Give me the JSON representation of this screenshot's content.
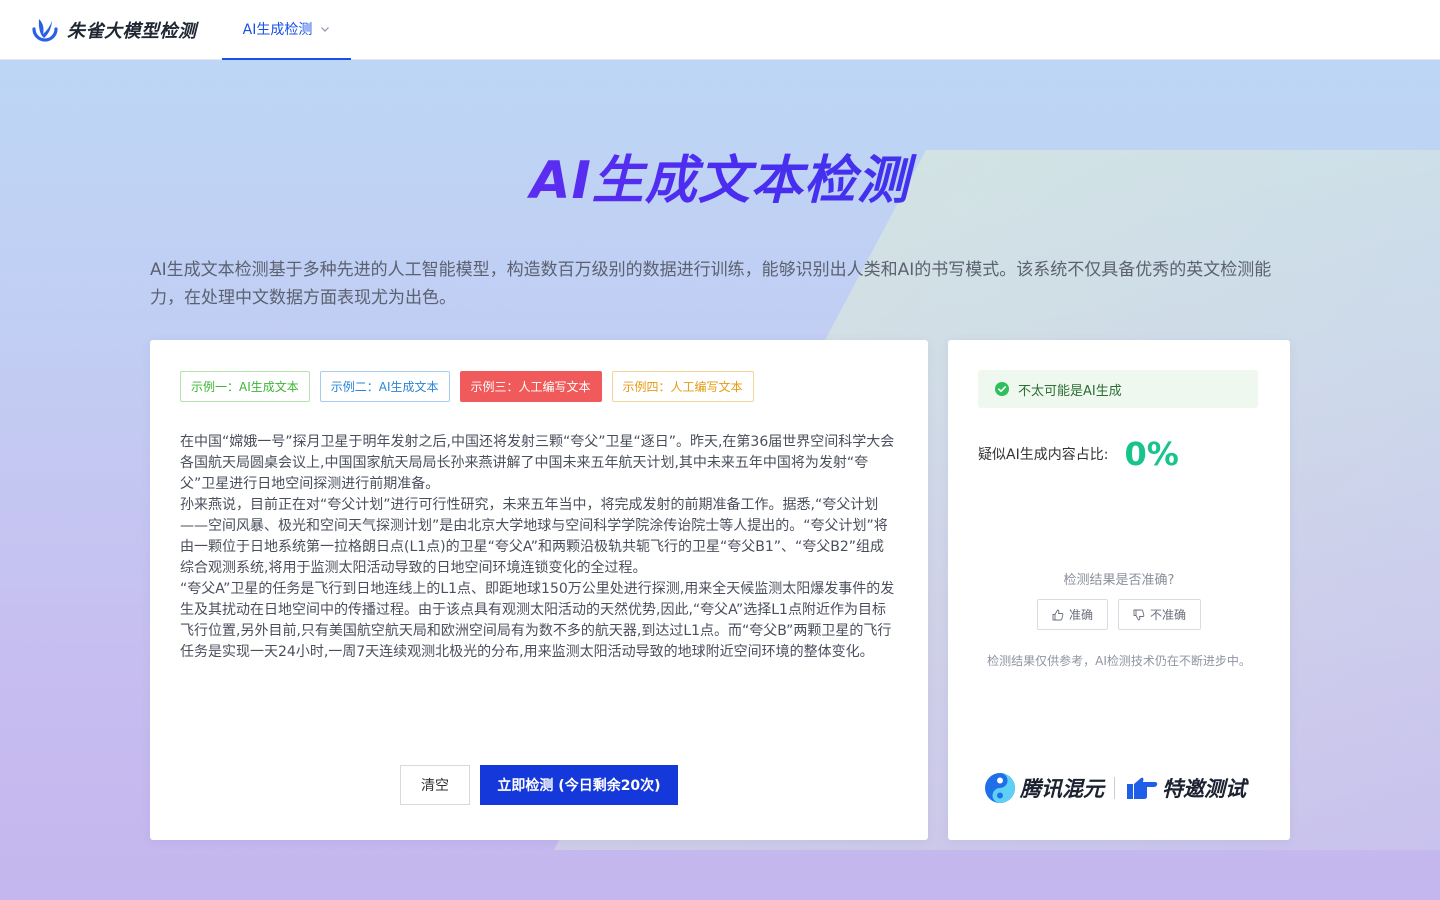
{
  "header": {
    "brand": "朱雀大模型检测",
    "nav_tab": "AI生成检测"
  },
  "hero": {
    "title": "AI生成文本检测",
    "description": "AI生成文本检测基于多种先进的人工智能模型，构造数百万级别的数据进行训练，能够识别出人类和AI的书写模式。该系统不仅具备优秀的英文检测能力，在处理中文数据方面表现尤为出色。"
  },
  "examples": [
    "示例一：AI生成文本",
    "示例二：AI生成文本",
    "示例三：人工编写文本",
    "示例四：人工编写文本"
  ],
  "input_text": {
    "paragraphs": [
      "在中国“嫦娥一号”探月卫星于明年发射之后,中国还将发射三颗“夸父”卫星“逐日”。昨天,在第36届世界空间科学大会各国航天局圆桌会议上,中国国家航天局局长孙来燕讲解了中国未来五年航天计划,其中未来五年中国将为发射“夸父”卫星进行日地空间探测进行前期准备。",
      "孙来燕说，目前正在对“夸父计划”进行可行性研究，未来五年当中，将完成发射的前期准备工作。据悉,“夸父计划——空间风暴、极光和空间天气探测计划”是由北京大学地球与空间科学学院涂传诒院士等人提出的。“夸父计划”将由一颗位于日地系统第一拉格朗日点(L1点)的卫星“夸父A”和两颗沿极轨共轭飞行的卫星“夸父B1”、“夸父B2”组成综合观测系统,将用于监测太阳活动导致的日地空间环境连锁变化的全过程。",
      "“夸父A”卫星的任务是飞行到日地连线上的L1点、即距地球150万公里处进行探测,用来全天候监测太阳爆发事件的发生及其扰动在日地空间中的传播过程。由于该点具有观测太阳活动的天然优势,因此,“夸父A”选择L1点附近作为目标飞行位置,另外目前,只有美国航空航天局和欧洲空间局有为数不多的航天器,到达过L1点。而“夸父B”两颗卫星的飞行任务是实现一天24小时,一周7天连续观测北极光的分布,用来监测太阳活动导致的地球附近空间环境的整体变化。"
    ]
  },
  "actions": {
    "clear": "清空",
    "detect": "立即检测 (今日剩余20次)"
  },
  "result": {
    "verdict": "不太可能是AI生成",
    "ratio_label": "疑似AI生成内容占比:",
    "ratio_value": "0%",
    "feedback_question": "检测结果是否准确?",
    "accurate": "准确",
    "inaccurate": "不准确",
    "disclaimer": "检测结果仅供参考，AI检测技术仍在不断进步中。"
  },
  "partner": {
    "name": "腾讯混元",
    "tagline": "特邀测试"
  },
  "colors": {
    "primary": "#1538db",
    "accent_green": "#19c38c",
    "example_red": "#f05a5a"
  }
}
